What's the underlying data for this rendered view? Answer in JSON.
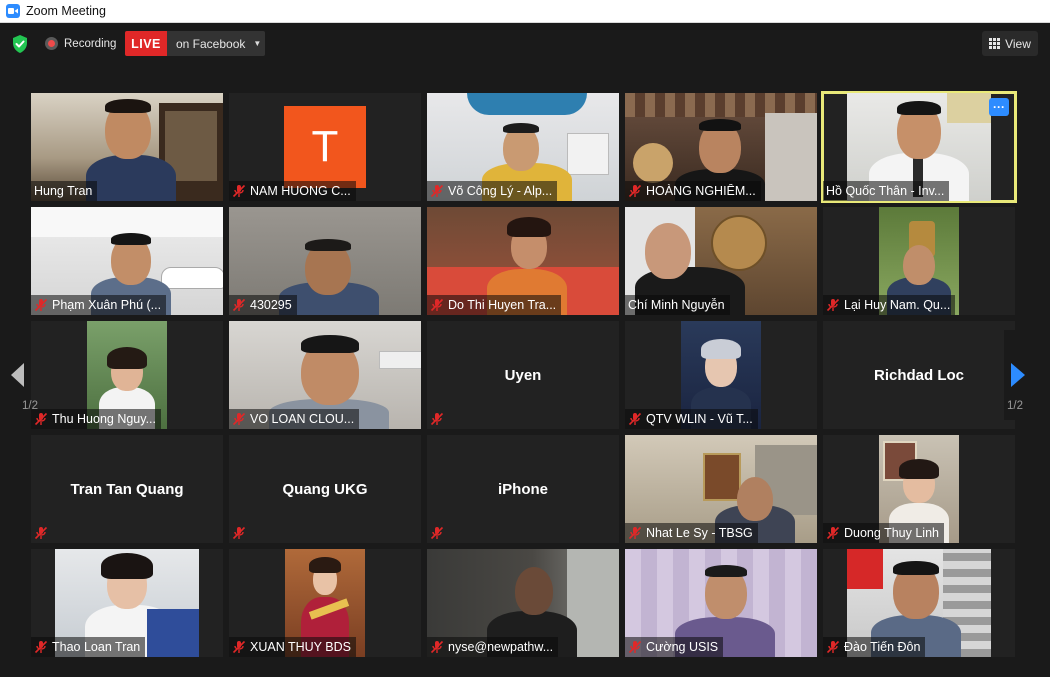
{
  "window": {
    "title": "Zoom Meeting"
  },
  "toolbar": {
    "recording_label": "Recording",
    "live_label": "LIVE",
    "stream_target": "on Facebook",
    "view_label": "View"
  },
  "pagination": {
    "left": "1/2",
    "right": "1/2"
  },
  "colors": {
    "accent": "#2d8cff",
    "live": "#e02828",
    "active_speaker": "#e9e979",
    "mic_off": "#e02828",
    "avatar_t": "#f2561d"
  },
  "icons": [
    "zoom-app-icon",
    "security-shield-icon",
    "recording-icon",
    "dropdown-caret-icon",
    "grid-view-icon",
    "mic-off-icon",
    "more-options-icon",
    "previous-page-arrow-icon",
    "next-page-arrow-icon"
  ],
  "participants": [
    {
      "name": "Hung Tran",
      "kind": "video",
      "muted": false
    },
    {
      "name": "NAM HUONG C...",
      "kind": "avatar",
      "initial": "T",
      "muted": true
    },
    {
      "name": "Võ Công Lý - Alp...",
      "kind": "video",
      "muted": true
    },
    {
      "name": "HOÀNG NGHIÊM...",
      "kind": "video",
      "muted": true
    },
    {
      "name": "Hồ Quốc Thân - Inv...",
      "kind": "video",
      "muted": false,
      "active": true
    },
    {
      "name": "Phạm Xuân Phú (...",
      "kind": "video",
      "muted": true
    },
    {
      "name": "430295",
      "kind": "video",
      "muted": true
    },
    {
      "name": "Do Thi Huyen Tra...",
      "kind": "video",
      "muted": true
    },
    {
      "name": "Chí Minh Nguyễn",
      "kind": "video",
      "muted": false
    },
    {
      "name": "Lại Huy Nam. Qu...",
      "kind": "video",
      "muted": true
    },
    {
      "name": "Thu Huong Nguy...",
      "kind": "video",
      "muted": true
    },
    {
      "name": "VO LOAN CLOU...",
      "kind": "video",
      "muted": true
    },
    {
      "name": "Uyen",
      "kind": "name",
      "muted": true
    },
    {
      "name": "QTV WLIN - Vũ T...",
      "kind": "video",
      "muted": true
    },
    {
      "name": "Richdad Loc",
      "kind": "name",
      "muted": true
    },
    {
      "name": "Tran Tan Quang",
      "kind": "name",
      "muted": true
    },
    {
      "name": "Quang UKG",
      "kind": "name",
      "muted": true
    },
    {
      "name": "iPhone",
      "kind": "name",
      "muted": true
    },
    {
      "name": "Nhat Le Sy - TBSG",
      "kind": "video",
      "muted": true
    },
    {
      "name": "Duong Thuy Linh",
      "kind": "video",
      "muted": true
    },
    {
      "name": "Thao Loan Tran",
      "kind": "video",
      "muted": true
    },
    {
      "name": "XUAN THUY BDS",
      "kind": "video",
      "muted": true
    },
    {
      "name": "nyse@newpathw...",
      "kind": "video",
      "muted": true
    },
    {
      "name": "Cường USIS",
      "kind": "video",
      "muted": true
    },
    {
      "name": "Đào Tiến Đôn",
      "kind": "video",
      "muted": true
    }
  ]
}
